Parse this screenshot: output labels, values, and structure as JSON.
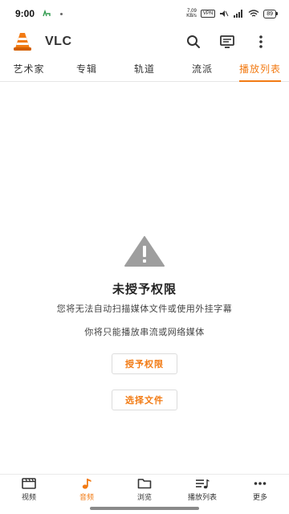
{
  "status_bar": {
    "time": "9:00",
    "net_speed_value": "7.09",
    "net_speed_unit": "KB/s",
    "vpn": "VPN",
    "battery": "89"
  },
  "app_bar": {
    "title": "VLC",
    "logo_icon": "vlc-cone-icon",
    "search_icon": "search-icon",
    "cast_icon": "renderer-icon",
    "more_icon": "more-vertical-icon"
  },
  "tabs": [
    {
      "label": "艺术家",
      "active": false
    },
    {
      "label": "专辑",
      "active": false
    },
    {
      "label": "轨道",
      "active": false
    },
    {
      "label": "流派",
      "active": false
    },
    {
      "label": "播放列表",
      "active": true
    }
  ],
  "permission": {
    "icon": "warning-icon",
    "title": "未授予权限",
    "description": "您将无法自动扫描媒体文件或使用外挂字幕",
    "description2": "你将只能播放串流或网络媒体",
    "grant_label": "授予权限",
    "pick_label": "选择文件"
  },
  "bottom_nav": [
    {
      "label": "视频",
      "icon": "video-icon",
      "active": false
    },
    {
      "label": "音频",
      "icon": "music-icon",
      "active": true
    },
    {
      "label": "浏览",
      "icon": "folder-icon",
      "active": false
    },
    {
      "label": "播放列表",
      "icon": "playlist-icon",
      "active": false
    },
    {
      "label": "更多",
      "icon": "more-horizontal-icon",
      "active": false
    }
  ],
  "colors": {
    "accent": "#f27b14",
    "warning_icon": "#9e9e9e"
  }
}
